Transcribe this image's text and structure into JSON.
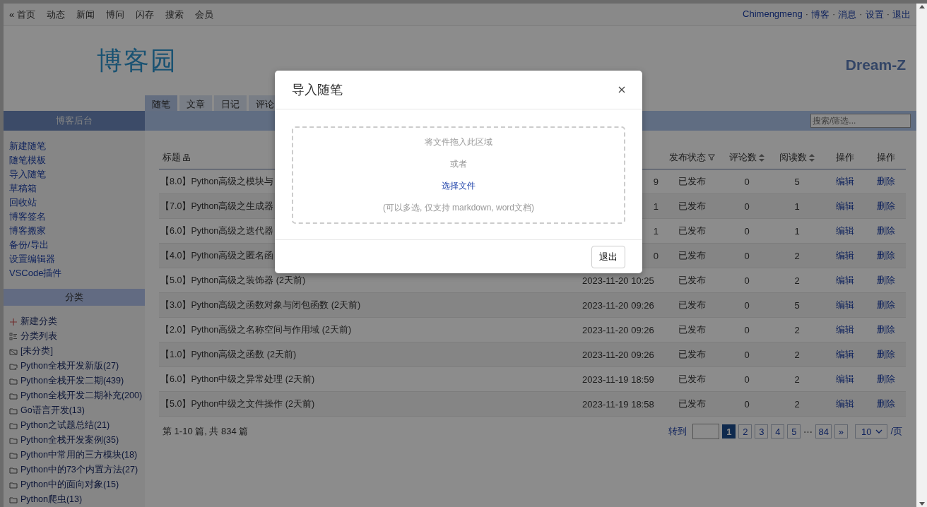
{
  "top_nav": {
    "links": [
      "« 首页",
      "动态",
      "新闻",
      "博问",
      "闪存",
      "搜索",
      "会员"
    ],
    "user_items": [
      {
        "kind": "link",
        "label": "Chimengmeng"
      },
      {
        "kind": "separator",
        "label": "·"
      },
      {
        "kind": "link",
        "label": "博客"
      },
      {
        "kind": "separator",
        "label": "·"
      },
      {
        "kind": "link",
        "label": "消息"
      },
      {
        "kind": "separator",
        "label": "·"
      },
      {
        "kind": "link",
        "label": "设置"
      },
      {
        "kind": "separator",
        "label": "·"
      },
      {
        "kind": "link",
        "label": "退出"
      }
    ]
  },
  "header": {
    "logo": "博客园",
    "blog_title": "Dream-Z"
  },
  "tabs": [
    {
      "label": "随笔",
      "selected": true
    },
    {
      "label": "文章",
      "selected": false
    },
    {
      "label": "日记",
      "selected": false
    },
    {
      "label": "评论",
      "selected": false
    }
  ],
  "search": {
    "placeholder": "搜索/筛选..."
  },
  "sidebar": {
    "title": "博客后台",
    "links": [
      "新建随笔",
      "随笔模板",
      "导入随笔",
      "草稿箱",
      "回收站",
      "博客签名",
      "博客搬家",
      "备份/导出",
      "设置编辑器",
      "VSCode插件"
    ],
    "category_title": "分类",
    "categories": [
      {
        "kind": "add",
        "label": "新建分类"
      },
      {
        "kind": "list",
        "label": "分类列表"
      },
      {
        "kind": "uncategorized",
        "label": "[未分类]"
      },
      {
        "kind": "folder-new",
        "label": "Python全栈开发新版(27)"
      },
      {
        "kind": "folder",
        "label": "Python全栈开发二期(439)"
      },
      {
        "kind": "folder",
        "label": "Python全栈开发二期补充(200)"
      },
      {
        "kind": "folder",
        "label": "Go语言开发(13)"
      },
      {
        "kind": "folder",
        "label": "Python之试题总结(21)"
      },
      {
        "kind": "folder",
        "label": "Python全栈开发案例(35)"
      },
      {
        "kind": "folder",
        "label": "Python中常用的三方模块(18)"
      },
      {
        "kind": "folder",
        "label": "Python中的73个内置方法(27)"
      },
      {
        "kind": "folder",
        "label": "Python中的面向对象(15)"
      },
      {
        "kind": "folder",
        "label": "Python爬虫(13)"
      }
    ]
  },
  "table": {
    "columns": [
      {
        "label": "标题"
      },
      {},
      {
        "label": "发布状态"
      },
      {
        "label": "评论数"
      },
      {
        "label": "阅读数"
      },
      {
        "label": "操作"
      },
      {
        "label": "操作"
      }
    ],
    "rows": [
      {
        "title": "【8.0】Python高级之模块与",
        "date": "9",
        "date_cut": true,
        "status": "已发布",
        "comments": "0",
        "reads": "5",
        "edit": "编辑",
        "delete": "删除"
      },
      {
        "title": "【7.0】Python高级之生成器",
        "date": "1",
        "date_cut": true,
        "status": "已发布",
        "comments": "0",
        "reads": "1",
        "edit": "编辑",
        "delete": "删除"
      },
      {
        "title": "【6.0】Python高级之迭代器",
        "date": "1",
        "date_cut": true,
        "status": "已发布",
        "comments": "0",
        "reads": "1",
        "edit": "编辑",
        "delete": "删除"
      },
      {
        "title": "【4.0】Python高级之匿名函",
        "date": "0",
        "date_cut": true,
        "status": "已发布",
        "comments": "0",
        "reads": "2",
        "edit": "编辑",
        "delete": "删除"
      },
      {
        "title": "【5.0】Python高级之装饰器 (2天前)",
        "date": "2023-11-20 10:25",
        "date_cut": false,
        "status": "已发布",
        "comments": "0",
        "reads": "2",
        "edit": "编辑",
        "delete": "删除"
      },
      {
        "title": "【3.0】Python高级之函数对象与闭包函数 (2天前)",
        "date": "2023-11-20 09:26",
        "date_cut": false,
        "status": "已发布",
        "comments": "0",
        "reads": "5",
        "edit": "编辑",
        "delete": "删除"
      },
      {
        "title": "【2.0】Python高级之名称空间与作用域 (2天前)",
        "date": "2023-11-20 09:26",
        "date_cut": false,
        "status": "已发布",
        "comments": "0",
        "reads": "2",
        "edit": "编辑",
        "delete": "删除"
      },
      {
        "title": "【1.0】Python高级之函数 (2天前)",
        "date": "2023-11-20 09:26",
        "date_cut": false,
        "status": "已发布",
        "comments": "0",
        "reads": "2",
        "edit": "编辑",
        "delete": "删除"
      },
      {
        "title": "【6.0】Python中级之异常处理 (2天前)",
        "date": "2023-11-19 18:59",
        "date_cut": false,
        "status": "已发布",
        "comments": "0",
        "reads": "2",
        "edit": "编辑",
        "delete": "删除"
      },
      {
        "title": "【5.0】Python中级之文件操作 (2天前)",
        "date": "2023-11-19 18:58",
        "date_cut": false,
        "status": "已发布",
        "comments": "0",
        "reads": "2",
        "edit": "编辑",
        "delete": "删除"
      }
    ]
  },
  "footer": {
    "summary": "第 1-10 篇, 共 834 篇",
    "goto_label": "转到",
    "pages": [
      {
        "kind": "page",
        "label": "1",
        "selected": true
      },
      {
        "kind": "page",
        "label": "2",
        "selected": false
      },
      {
        "kind": "page",
        "label": "3",
        "selected": false
      },
      {
        "kind": "page",
        "label": "4",
        "selected": false
      },
      {
        "kind": "page",
        "label": "5",
        "selected": false
      },
      {
        "kind": "ellipsis",
        "label": "⋯",
        "selected": false
      },
      {
        "kind": "page",
        "label": "84",
        "selected": false
      },
      {
        "kind": "page",
        "label": "»",
        "selected": false
      }
    ],
    "page_size": "10",
    "page_size_suffix": "/页"
  },
  "modal": {
    "title": "导入随笔",
    "drop_hint": "将文件拖入此区域",
    "or": "或者",
    "choose": "选择文件",
    "note": "(可以多选, 仅支持 markdown, word文档)",
    "exit": "退出"
  }
}
